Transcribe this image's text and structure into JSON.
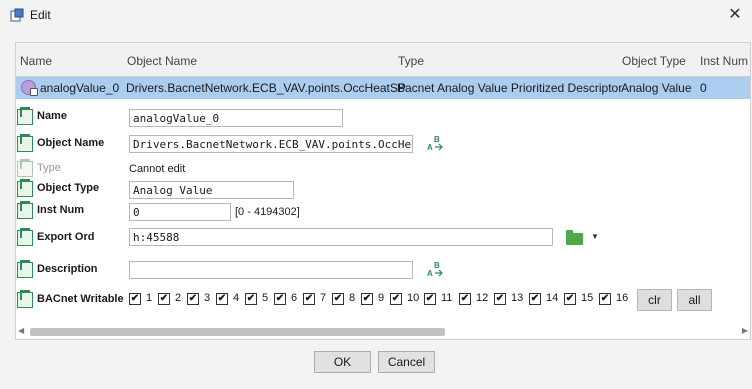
{
  "window": {
    "title": "Edit",
    "close_glyph": "✕"
  },
  "table": {
    "headers": [
      "Name",
      "Object Name",
      "Type",
      "Object Type",
      "Inst Num"
    ],
    "selected_row": {
      "name": "analogValue_0",
      "object_name": "Drivers.BacnetNetwork.ECB_VAV.points.OccHeatSP",
      "type": "Bacnet Analog Value Prioritized Descriptor",
      "object_type": "Analog Value",
      "inst_num": "0"
    }
  },
  "props": {
    "name_label": "Name",
    "name_value": "analogValue_0",
    "object_name_label": "Object Name",
    "object_name_value": "Drivers.BacnetNetwork.ECB_VAV.points.OccHeatSP",
    "type_label": "Type",
    "type_value": "Cannot edit",
    "object_type_label": "Object Type",
    "object_type_value": "Analog Value",
    "inst_num_label": "Inst Num",
    "inst_num_value": "0",
    "inst_num_range": "[0 - 4194302]",
    "export_ord_label": "Export Ord",
    "export_ord_value": "h:45588",
    "description_label": "Description",
    "description_value": "",
    "bacnet_writable_label": "BACnet Writable",
    "writable_numbers": [
      "1",
      "2",
      "3",
      "4",
      "5",
      "6",
      "7",
      "8",
      "9",
      "10",
      "11",
      "12",
      "13",
      "14",
      "15",
      "16"
    ],
    "clr_label": "clr",
    "all_label": "all",
    "check_glyph": "✔"
  },
  "footer": {
    "ok_label": "OK",
    "cancel_label": "Cancel"
  },
  "icons": {
    "app": "edit-app-icon",
    "row": "analog-value-point-icon",
    "property": "property-slot-icon",
    "rename": "ab-rename-icon",
    "folder": "folder-icon",
    "dropdown": "chevron-down-icon"
  },
  "colors": {
    "selection": "#aacdf0",
    "accent_green": "#2e8b57"
  }
}
